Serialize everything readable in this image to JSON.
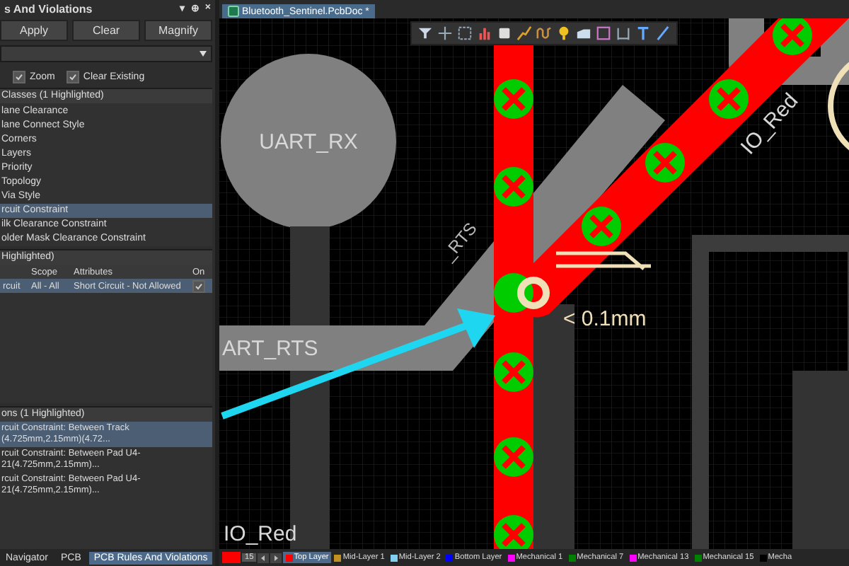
{
  "panel": {
    "title": "s And Violations",
    "title_icons": [
      "▾",
      "⊕",
      "×"
    ],
    "buttons": [
      "Apply",
      "Clear",
      "Magnify"
    ],
    "options": [
      {
        "label": "Zoom",
        "checked": true
      },
      {
        "label": "Clear Existing",
        "checked": true
      }
    ],
    "classes": {
      "header": "Classes (1 Highlighted)",
      "items": [
        {
          "label": "lane Clearance",
          "selected": false
        },
        {
          "label": "lane Connect Style",
          "selected": false
        },
        {
          "label": "Corners",
          "selected": false
        },
        {
          "label": "Layers",
          "selected": false
        },
        {
          "label": "Priority",
          "selected": false
        },
        {
          "label": "Topology",
          "selected": false
        },
        {
          "label": "Via Style",
          "selected": false
        },
        {
          "label": "rcuit Constraint",
          "selected": true
        },
        {
          "label": "ilk Clearance Constraint",
          "selected": false
        },
        {
          "label": "older Mask Clearance Constraint",
          "selected": false
        }
      ]
    },
    "rules": {
      "header": "Highlighted)",
      "columns": [
        "Scope",
        "Attributes",
        "On"
      ],
      "rows": [
        {
          "name": "rcuit",
          "scope": "All - All",
          "attributes": "Short Circuit - Not Allowed",
          "on": true,
          "selected": true
        }
      ]
    },
    "violations": {
      "header": "ons (1 Highlighted)",
      "items": [
        {
          "label": "rcuit Constraint: Between Track (4.725mm,2.15mm)(4.72...",
          "selected": true
        },
        {
          "label": "rcuit Constraint: Between Pad U4-21(4.725mm,2.15mm)...",
          "selected": false
        },
        {
          "label": "rcuit Constraint: Between Pad U4-21(4.725mm,2.15mm)...",
          "selected": false
        }
      ]
    },
    "tabs": [
      {
        "label": "Navigator",
        "selected": false
      },
      {
        "label": "PCB",
        "selected": false
      },
      {
        "label": "PCB Rules And Violations",
        "selected": true
      }
    ]
  },
  "document_tab": {
    "label": "Bluetooth_Sentinel.PcbDoc *",
    "selected": true
  },
  "canvas": {
    "pad_label": "UART_RX",
    "track_label": "ART_RTS",
    "diagonal_label": "_RTS",
    "net_label_top": "IO_Red",
    "net_label_bottom": "IO_Red",
    "measure": "< 0.1mm"
  },
  "status_bar": {
    "count": "15",
    "layers": [
      {
        "label": "Top Layer",
        "color": "#ff0000",
        "selected": true
      },
      {
        "label": "Mid-Layer 1",
        "color": "#c09020",
        "selected": false
      },
      {
        "label": "Mid-Layer 2",
        "color": "#80d0f0",
        "selected": false
      },
      {
        "label": "Bottom Layer",
        "color": "#0000ff",
        "selected": false
      },
      {
        "label": "Mechanical 1",
        "color": "#ff00ff",
        "selected": false
      },
      {
        "label": "Mechanical 7",
        "color": "#008000",
        "selected": false
      },
      {
        "label": "Mechanical 13",
        "color": "#ff00ff",
        "selected": false
      },
      {
        "label": "Mechanical 15",
        "color": "#008000",
        "selected": false
      },
      {
        "label": "Mecha",
        "color": "#000000",
        "selected": false
      }
    ]
  }
}
